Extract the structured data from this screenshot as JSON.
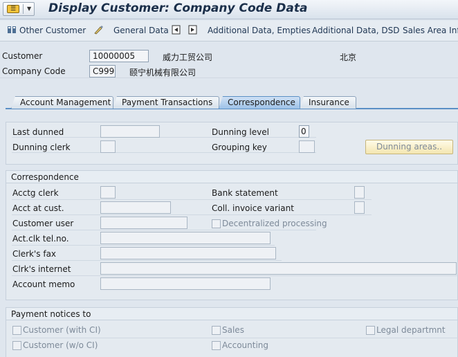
{
  "window": {
    "title": "Display Customer: Company Code Data",
    "menu_icon": "sap-menu-icon"
  },
  "toolbar": {
    "other_customer": "Other Customer",
    "general_data": "General Data",
    "additional_empties": "Additional Data, Empties",
    "additional_dsd": "Additional Data, DSD",
    "sales_area": "Sales Area Info"
  },
  "header": {
    "customer_label": "Customer",
    "customer_value": "10000005",
    "customer_name": "威力工贸公司",
    "customer_city": "北京",
    "company_code_label": "Company Code",
    "company_code_value": "C999",
    "company_name": "颐宁机械有限公司"
  },
  "tabs": [
    {
      "label": "Account Management",
      "active": false
    },
    {
      "label": "Payment Transactions",
      "active": false
    },
    {
      "label": "Correspondence",
      "active": true
    },
    {
      "label": "Insurance",
      "active": false
    }
  ],
  "dunning": {
    "last_dunned_label": "Last dunned",
    "last_dunned_value": "",
    "dunning_level_label": "Dunning level",
    "dunning_level_value": "0",
    "dunning_clerk_label": "Dunning clerk",
    "dunning_clerk_value": "",
    "grouping_key_label": "Grouping key",
    "grouping_key_value": "",
    "dunning_areas_button": "Dunning areas.."
  },
  "correspondence": {
    "title": "Correspondence",
    "acctg_clerk_label": "Acctg clerk",
    "bank_statement_label": "Bank statement",
    "acct_at_cust_label": "Acct at cust.",
    "coll_invoice_variant_label": "Coll. invoice variant",
    "customer_user_label": "Customer user",
    "decentralized_processing_label": "Decentralized processing",
    "act_clk_tel_label": "Act.clk tel.no.",
    "clerks_fax_label": "Clerk's fax",
    "clrks_internet_label": "Clrk's internet",
    "account_memo_label": "Account memo"
  },
  "payment_notices": {
    "title": "Payment notices to",
    "customer_with_ci": "Customer (with CI)",
    "sales": "Sales",
    "legal_department": "Legal departmnt",
    "customer_wo_ci": "Customer (w/o CI)",
    "accounting": "Accounting"
  }
}
